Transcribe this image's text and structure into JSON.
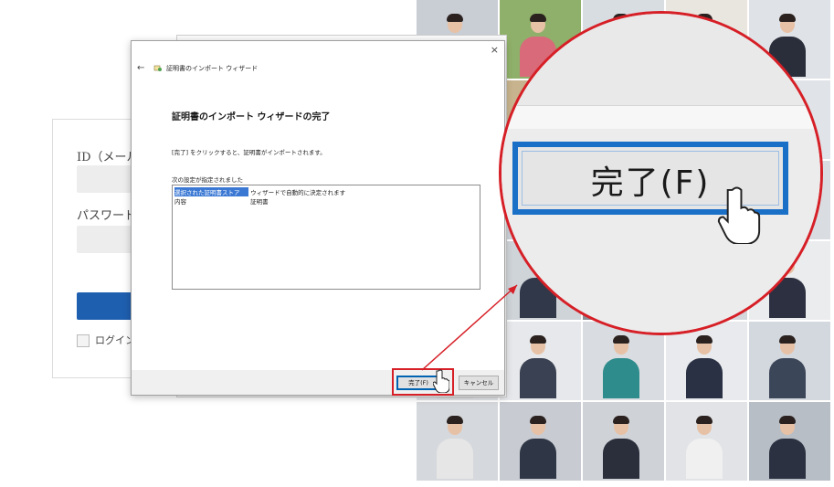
{
  "login": {
    "id_label": "ID（メールア",
    "password_label": "パスワード",
    "remember_label": "ログイン状"
  },
  "wizard": {
    "back_icon": "back-arrow-icon",
    "title": "証明書のインポート ウィザード",
    "heading": "証明書のインポート ウィザードの完了",
    "description": "[完了] をクリックすると、証明書がインポートされます。",
    "settings_label": "次の設定が指定されました",
    "settings": [
      {
        "key": "選択された証明書ストア",
        "value": "ウィザードで自動的に決定されます"
      },
      {
        "key": "内容",
        "value": "証明書"
      }
    ],
    "finish_button": "完了(F)",
    "cancel_button": "キャンセル",
    "close_glyph": "×",
    "back_glyph": "←"
  },
  "magnifier": {
    "label": "完了(F)"
  },
  "colors": {
    "accent_red": "#d61f26",
    "button_blue": "#1a6fc6",
    "selection_blue": "#3a78d4",
    "login_button": "#1f5fb0"
  },
  "photos": {
    "tiles": [
      {
        "bg": "#c9cdd4",
        "suit": "#2c3140"
      },
      {
        "bg": "#8fb06a",
        "suit": "#d96a7a"
      },
      {
        "bg": "#d8dde2",
        "suit": "#2d3340"
      },
      {
        "bg": "#e9e6e0",
        "suit": "#34394a"
      },
      {
        "bg": "#dfe2e6",
        "suit": "#2a2e3a"
      },
      {
        "bg": "#b9c2ca",
        "suit": "#3a4150"
      },
      {
        "bg": "#c7b48e",
        "suit": "#6b6f7a"
      },
      {
        "bg": "#e3e6ea",
        "suit": "#30343f"
      },
      {
        "bg": "#d6d9dd",
        "suit": "#f2b400"
      },
      {
        "bg": "#e0e3e7",
        "suit": "#2d3140"
      },
      {
        "bg": "#aab3bb",
        "suit": "#3b4250"
      },
      {
        "bg": "#cbd2d8",
        "suit": "#44505c"
      },
      {
        "bg": "#e7e7e7",
        "suit": "#2f3442"
      },
      {
        "bg": "#dfe6ec",
        "suit": "#1e2838"
      },
      {
        "bg": "#d9dde2",
        "suit": "#2b3140"
      },
      {
        "bg": "#e9ebee",
        "suit": "#2d3242"
      },
      {
        "bg": "#cfd4d9",
        "suit": "#31384a"
      },
      {
        "bg": "#8a8f96",
        "suit": "#2a2f3c"
      },
      {
        "bg": "#d4d8dd",
        "suit": "#24344f"
      },
      {
        "bg": "#ebecee",
        "suit": "#2d3040"
      },
      {
        "bg": "#e2e4e8",
        "suit": "#d9d9d9"
      },
      {
        "bg": "#e6e8eb",
        "suit": "#3a4152"
      },
      {
        "bg": "#d9dce0",
        "suit": "#2f8c8c"
      },
      {
        "bg": "#e8eaed",
        "suit": "#2b3144"
      },
      {
        "bg": "#d3d8de",
        "suit": "#3c4659"
      },
      {
        "bg": "#d5d8dc",
        "suit": "#e6e6e6"
      },
      {
        "bg": "#c8ccd2",
        "suit": "#2f3646"
      },
      {
        "bg": "#cfd3d8",
        "suit": "#2a2f3b"
      },
      {
        "bg": "#e1e3e6",
        "suit": "#f0f0f0"
      },
      {
        "bg": "#b7bec6",
        "suit": "#2b3140"
      }
    ]
  }
}
